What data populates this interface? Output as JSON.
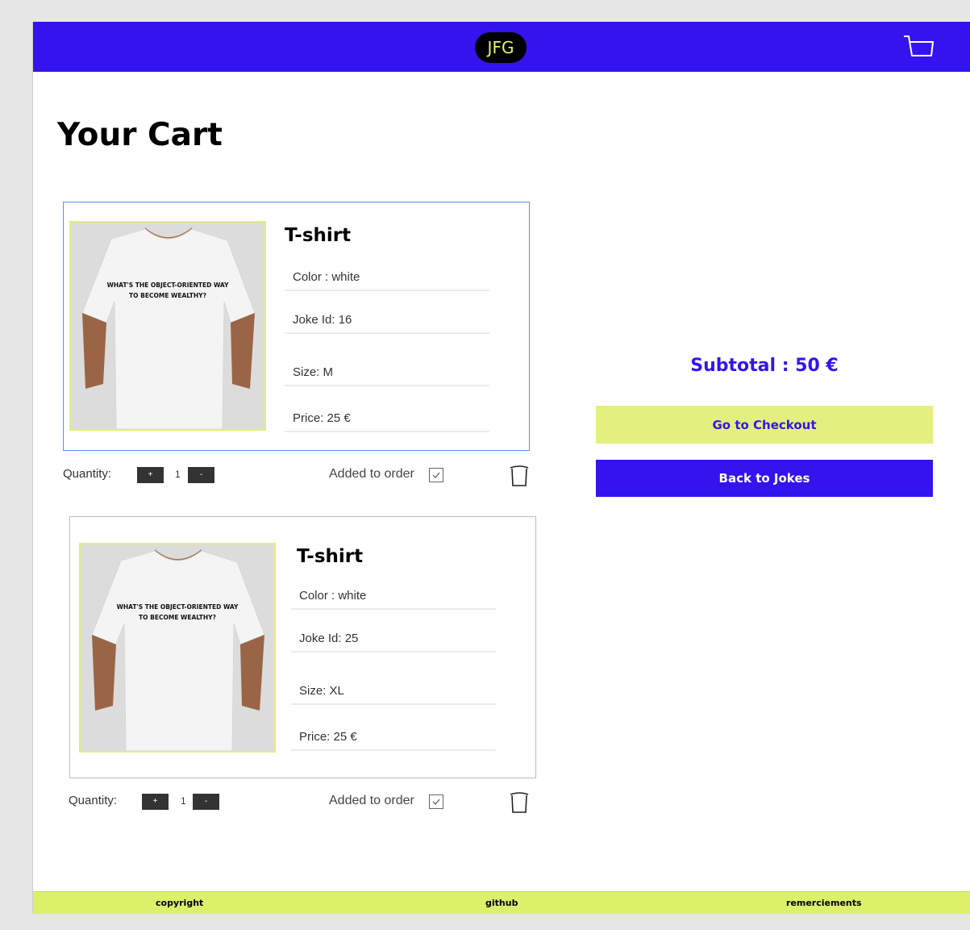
{
  "header": {
    "logo_text": "JFG",
    "cart_icon": "shopping-cart-icon",
    "bg_color": "#3314ee"
  },
  "page": {
    "title": "Your Cart"
  },
  "cart_items": [
    {
      "name": "T-shirt",
      "image_caption_line1": "WHAT'S THE OBJECT-ORIENTED WAY",
      "image_caption_line2": "TO BECOME WEALTHY?",
      "color": "Color : white",
      "joke_id": "Joke Id: 16",
      "size": "Size: M",
      "price": "Price: 25 €",
      "quantity_label": "Quantity:",
      "plus_label": "+",
      "quantity": "1",
      "minus_label": "-",
      "order_label": "Added to order",
      "added_to_order": true
    },
    {
      "name": "T-shirt",
      "image_caption_line1": "WHAT'S THE OBJECT-ORIENTED WAY",
      "image_caption_line2": "TO BECOME WEALTHY?",
      "color": "Color : white",
      "joke_id": "Joke Id: 25",
      "size": "Size: XL",
      "price": "Price: 25 €",
      "quantity_label": "Quantity:",
      "plus_label": "+",
      "quantity": "1",
      "minus_label": "-",
      "order_label": "Added to order",
      "added_to_order": true
    }
  ],
  "summary": {
    "subtotal": "Subtotal : 50 €",
    "checkout_label": "Go to Checkout",
    "back_label": "Back to Jokes"
  },
  "footer": {
    "copyright": "copyright",
    "github": "github",
    "thanks": "remerciements"
  },
  "colors": {
    "accent_blue": "#3314ee",
    "accent_yellow": "#e3f07f",
    "footer_yellow": "#dcf06a"
  }
}
